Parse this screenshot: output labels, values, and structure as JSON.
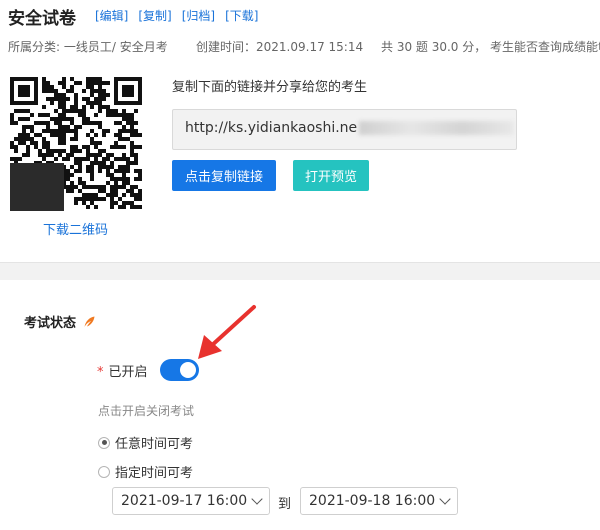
{
  "header": {
    "title": "安全试卷",
    "actions": [
      "[编辑]",
      "[复制]",
      "[归档]",
      "[下载]"
    ]
  },
  "meta": {
    "category": "所属分类: 一线员工/ 安全月考",
    "created": "创建时间：2021.09.17 15:14",
    "summary": "共 30 题 30.0 分，  考生能否查询成绩能够"
  },
  "share": {
    "qr_download": "下载二维码",
    "hint": "复制下面的链接并分享给您的考生",
    "link_visible": "http://ks.yidiankaoshi.ne",
    "copy_button": "点击复制链接",
    "preview_button": "打开预览"
  },
  "exam_status": {
    "section_title": "考试状态",
    "required_mark": "*",
    "switch_label": "已开启",
    "switch_on": true,
    "hint": "点击开启关闭考试",
    "options": [
      {
        "label": "任意时间可考",
        "checked": true
      },
      {
        "label": "指定时间可考",
        "checked": false
      }
    ],
    "start_time": "2021-09-17 16:00",
    "to": "到",
    "end_time": "2021-09-18 16:00"
  },
  "colors": {
    "primary": "#1677e6",
    "teal": "#25c3c0",
    "link": "#1a73d9",
    "annotation": "#e8322e"
  }
}
